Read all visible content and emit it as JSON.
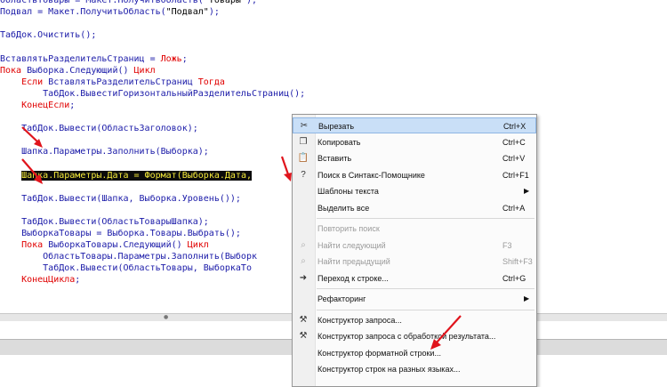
{
  "code": {
    "lines": [
      [
        {
          "t": "ОбластьТовары = Макет.ПолучитьОбласть(",
          "c": "code"
        },
        {
          "t": "\"Товары\"",
          "c": "str"
        },
        {
          "t": ");",
          "c": "code"
        }
      ],
      [
        {
          "t": "Подвал = Макет.ПолучитьОбласть(",
          "c": "code"
        },
        {
          "t": "\"Подвал\"",
          "c": "str"
        },
        {
          "t": ");",
          "c": "code"
        }
      ],
      [],
      [
        {
          "t": "ТабДок.Очистить();",
          "c": "code"
        }
      ],
      [],
      [
        {
          "t": "ВставлятьРазделительСтраниц = ",
          "c": "code"
        },
        {
          "t": "Ложь",
          "c": "bool"
        },
        {
          "t": ";",
          "c": "code"
        }
      ],
      [
        {
          "t": "Пока ",
          "c": "kw"
        },
        {
          "t": "Выборка.Следующий() ",
          "c": "code"
        },
        {
          "t": "Цикл",
          "c": "kw"
        }
      ],
      [
        {
          "t": "    Если ",
          "c": "kw"
        },
        {
          "t": "ВставлятьРазделительСтраниц ",
          "c": "code"
        },
        {
          "t": "Тогда",
          "c": "kw"
        }
      ],
      [
        {
          "t": "        ТабДок.ВывестиГоризонтальныйРазделительСтраниц();",
          "c": "code"
        }
      ],
      [
        {
          "t": "    КонецЕсли",
          "c": "kw"
        },
        {
          "t": ";",
          "c": "code"
        }
      ],
      [],
      [
        {
          "t": "    ТабДок.Вывести(ОбластьЗаголовок);",
          "c": "code"
        }
      ],
      [],
      [
        {
          "t": "    Шапка.Параметры.Заполнить(Выборка);",
          "c": "code"
        }
      ],
      [],
      [
        {
          "t": "    ",
          "c": "code"
        },
        {
          "t": "Шапка.Параметры.Дата ",
          "c": "hl"
        },
        {
          "t": "= ",
          "c": "hlop"
        },
        {
          "t": "Формат(Выборка.Дата,",
          "c": "hl"
        }
      ],
      [],
      [
        {
          "t": "    ТабДок.Вывести(Шапка, Выборка.Уровень());",
          "c": "code"
        }
      ],
      [],
      [
        {
          "t": "    ТабДок.Вывести(ОбластьТоварыШапка);",
          "c": "code"
        }
      ],
      [
        {
          "t": "    ВыборкаТовары = Выборка.Товары.Выбрать();",
          "c": "code"
        }
      ],
      [
        {
          "t": "    Пока ",
          "c": "kw"
        },
        {
          "t": "ВыборкаТовары.Следующий() ",
          "c": "code"
        },
        {
          "t": "Цикл",
          "c": "kw"
        }
      ],
      [
        {
          "t": "        ОбластьТовары.Параметры.Заполнить(Выборк",
          "c": "code"
        }
      ],
      [
        {
          "t": "        ТабДок.Вывести(ОбластьТовары, ВыборкаТо",
          "c": "code"
        }
      ],
      [
        {
          "t": "    КонецЦикла",
          "c": "kw"
        },
        {
          "t": ";",
          "c": "code"
        }
      ]
    ]
  },
  "context_menu": {
    "items": [
      {
        "type": "item",
        "label": "Вырезать",
        "shortcut": "Ctrl+X",
        "icon": "scissors-icon",
        "glyph": "✂",
        "selected": true,
        "disabled": false,
        "submenu": false
      },
      {
        "type": "item",
        "label": "Копировать",
        "shortcut": "Ctrl+C",
        "icon": "copy-icon",
        "glyph": "❐",
        "selected": false,
        "disabled": false,
        "submenu": false
      },
      {
        "type": "item",
        "label": "Вставить",
        "shortcut": "Ctrl+V",
        "icon": "paste-icon",
        "glyph": "📋",
        "selected": false,
        "disabled": false,
        "submenu": false
      },
      {
        "type": "item",
        "label": "Поиск в Синтакс-Помощнике",
        "shortcut": "Ctrl+F1",
        "icon": "syntax-help-icon",
        "glyph": "?",
        "selected": false,
        "disabled": false,
        "submenu": false
      },
      {
        "type": "item",
        "label": "Шаблоны текста",
        "shortcut": "",
        "icon": "",
        "glyph": "",
        "selected": false,
        "disabled": false,
        "submenu": true
      },
      {
        "type": "item",
        "label": "Выделить все",
        "shortcut": "Ctrl+A",
        "icon": "",
        "glyph": "",
        "selected": false,
        "disabled": false,
        "submenu": false
      },
      {
        "type": "sep"
      },
      {
        "type": "item",
        "label": "Повторить поиск",
        "shortcut": "",
        "icon": "",
        "glyph": "",
        "selected": false,
        "disabled": true,
        "submenu": false
      },
      {
        "type": "item",
        "label": "Найти следующий",
        "shortcut": "F3",
        "icon": "find-next-icon",
        "glyph": "⌕",
        "selected": false,
        "disabled": true,
        "submenu": false
      },
      {
        "type": "item",
        "label": "Найти предыдущий",
        "shortcut": "Shift+F3",
        "icon": "find-previous-icon",
        "glyph": "⌕",
        "selected": false,
        "disabled": true,
        "submenu": false
      },
      {
        "type": "item",
        "label": "Переход к строке...",
        "shortcut": "Ctrl+G",
        "icon": "goto-line-icon",
        "glyph": "➜",
        "selected": false,
        "disabled": false,
        "submenu": false
      },
      {
        "type": "sep"
      },
      {
        "type": "item",
        "label": "Рефакторинг",
        "shortcut": "",
        "icon": "",
        "glyph": "",
        "selected": false,
        "disabled": false,
        "submenu": true
      },
      {
        "type": "sep"
      },
      {
        "type": "item",
        "label": "Конструктор запроса...",
        "shortcut": "",
        "icon": "query-builder-icon",
        "glyph": "⚒",
        "selected": false,
        "disabled": false,
        "submenu": false
      },
      {
        "type": "item",
        "label": "Конструктор запроса с обработкой результата...",
        "shortcut": "",
        "icon": "query-builder-result-icon",
        "glyph": "⚒",
        "selected": false,
        "disabled": false,
        "submenu": false
      },
      {
        "type": "item",
        "label": "Конструктор форматной строки...",
        "shortcut": "",
        "icon": "",
        "glyph": "",
        "selected": false,
        "disabled": false,
        "submenu": false
      },
      {
        "type": "item",
        "label": "Конструктор строк на разных языках...",
        "shortcut": "",
        "icon": "",
        "glyph": "",
        "selected": false,
        "disabled": false,
        "submenu": false
      }
    ]
  },
  "colors": {
    "code": "#1a1aa8",
    "keyword": "#e00000",
    "highlight_bg": "#0b0b0b",
    "highlight_fg": "#f4ea3a",
    "annotation_arrow": "#e0141c",
    "menu_selection": "#c9dff7"
  }
}
